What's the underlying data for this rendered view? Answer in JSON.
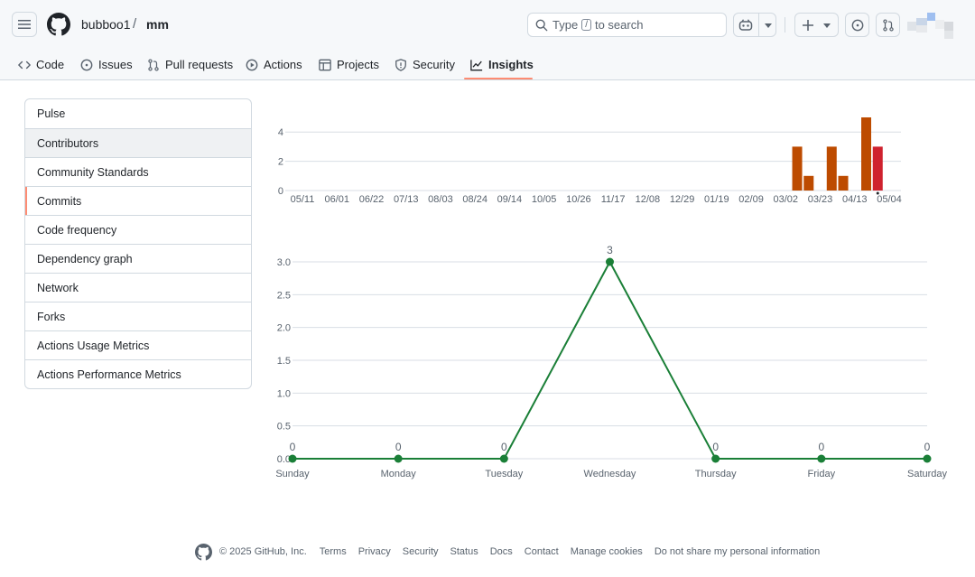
{
  "header": {
    "owner": "bubboo1",
    "separator": "/",
    "repo": "mm",
    "search": {
      "prefix": "Type",
      "key": "/",
      "suffix": "to search"
    }
  },
  "tabs": [
    {
      "label": "Code",
      "icon": "code-icon"
    },
    {
      "label": "Issues",
      "icon": "issue-icon"
    },
    {
      "label": "Pull requests",
      "icon": "pull-request-icon"
    },
    {
      "label": "Actions",
      "icon": "play-icon"
    },
    {
      "label": "Projects",
      "icon": "table-icon"
    },
    {
      "label": "Security",
      "icon": "shield-icon"
    },
    {
      "label": "Insights",
      "icon": "graph-icon",
      "active": true
    }
  ],
  "sidebar": {
    "items": [
      {
        "label": "Pulse"
      },
      {
        "label": "Contributors",
        "hover": true
      },
      {
        "label": "Community Standards"
      },
      {
        "label": "Commits",
        "selected": true
      },
      {
        "label": "Code frequency"
      },
      {
        "label": "Dependency graph"
      },
      {
        "label": "Network"
      },
      {
        "label": "Forks"
      },
      {
        "label": "Actions Usage Metrics"
      },
      {
        "label": "Actions Performance Metrics"
      }
    ]
  },
  "chart_data": [
    {
      "type": "bar",
      "title": "",
      "xlabel": "",
      "ylabel": "",
      "ylim": [
        0,
        5
      ],
      "yticks": [
        0,
        2,
        4
      ],
      "grid": true,
      "colors": {
        "default": "#bd4b00",
        "highlight": "#cf222e"
      },
      "tick_labels": [
        "05/11",
        "06/01",
        "06/22",
        "07/13",
        "08/03",
        "08/24",
        "09/14",
        "10/05",
        "10/26",
        "11/17",
        "12/08",
        "12/29",
        "01/19",
        "02/09",
        "03/02",
        "03/23",
        "04/13",
        "05/04"
      ],
      "weeks": 52,
      "values": [
        0,
        0,
        0,
        0,
        0,
        0,
        0,
        0,
        0,
        0,
        0,
        0,
        0,
        0,
        0,
        0,
        0,
        0,
        0,
        0,
        0,
        0,
        0,
        0,
        0,
        0,
        0,
        0,
        0,
        0,
        0,
        0,
        0,
        0,
        0,
        0,
        0,
        0,
        0,
        0,
        0,
        0,
        0,
        3,
        1,
        0,
        3,
        1,
        0,
        5,
        3,
        0
      ],
      "highlight_index": 50
    },
    {
      "type": "line",
      "title": "",
      "xlabel": "",
      "ylabel": "",
      "color": "#1a7f37",
      "categories": [
        "Sunday",
        "Monday",
        "Tuesday",
        "Wednesday",
        "Thursday",
        "Friday",
        "Saturday"
      ],
      "values": [
        0,
        0,
        0,
        3,
        0,
        0,
        0
      ],
      "ylim": [
        0,
        3.0
      ],
      "yticks": [
        "0.0",
        "0.5",
        "1.0",
        "1.5",
        "2.0",
        "2.5",
        "3.0"
      ],
      "grid": true,
      "data_labels": true
    }
  ],
  "footer": {
    "copyright": "© 2025 GitHub, Inc.",
    "links": [
      "Terms",
      "Privacy",
      "Security",
      "Status",
      "Docs",
      "Contact",
      "Manage cookies",
      "Do not share my personal information"
    ]
  }
}
